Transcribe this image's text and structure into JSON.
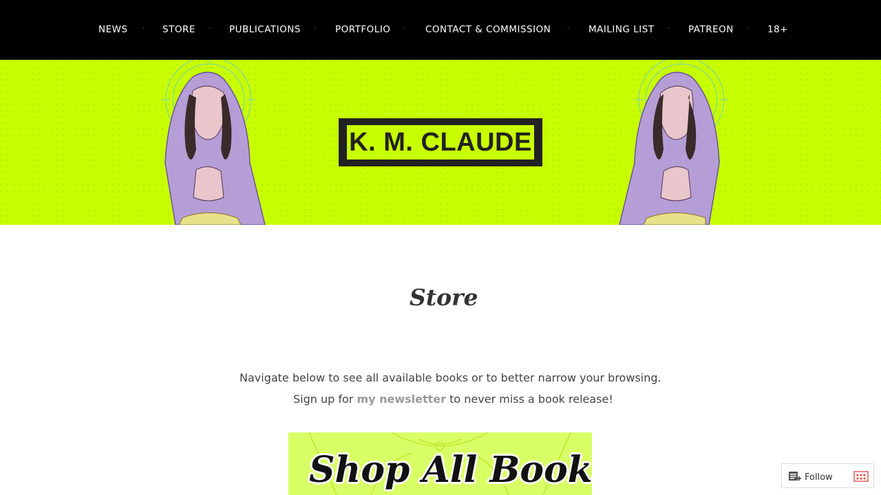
{
  "nav": {
    "items": [
      "NEWS",
      "STORE",
      "PUBLICATIONS",
      "PORTFOLIO",
      "CONTACT & COMMISSION",
      "MAILING LIST",
      "PATREON",
      "18+"
    ],
    "separator": "·"
  },
  "hero": {
    "title": "K. M. CLAUDE",
    "background_color": "#c8ff00"
  },
  "main": {
    "heading": "Store",
    "intro": "Navigate below to see all available books or to better narrow your browsing.",
    "signup_prefix": "Sign up for ",
    "signup_link": "my newsletter",
    "signup_suffix": " to never miss a book release!",
    "banner_label": "Shop All Books"
  },
  "widget": {
    "follow_label": "Follow",
    "icons": [
      "reader-follow-icon",
      "grid-icon"
    ]
  }
}
